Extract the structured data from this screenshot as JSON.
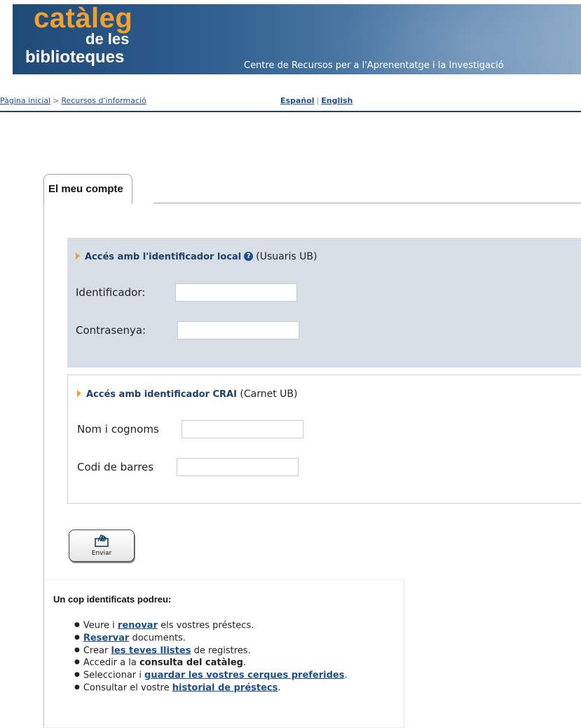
{
  "header": {
    "logo_line1": "catàleg",
    "logo_line2": "de les",
    "logo_line3": "biblioteques",
    "subtitle": "Centre de Recursos per a l'Aprenentatge i la Investigació"
  },
  "breadcrumb": {
    "home": "Pàgina inicial",
    "separator": ">",
    "current": "Recursos d'informació"
  },
  "languages": {
    "spanish": "Español",
    "divider": "|",
    "english": "English"
  },
  "account": {
    "tab_label": "El meu compte",
    "local": {
      "title_link": "Accés amb l'identificador local",
      "help_icon": "?",
      "title_suffix": "(Usuaris UB)",
      "id_label": "Identificador:",
      "id_value": "",
      "password_label": "Contrasenya:",
      "password_value": ""
    },
    "crai": {
      "title_link": "Accés amb identificador CRAI",
      "title_suffix": "(Carnet UB)",
      "name_label": "Nom i cognoms",
      "name_value": "",
      "barcode_label": "Codi de barres",
      "barcode_value": ""
    },
    "submit_label": "Enviar"
  },
  "info": {
    "title": "Un cop identificats podreu:",
    "items": [
      {
        "pre": "Veure i ",
        "link": "renovar",
        "post": " els vostres préstecs."
      },
      {
        "pre": "",
        "link": "Reservar",
        "post": " documents."
      },
      {
        "pre": "Crear ",
        "link": "les teves llistes",
        "post": " de registres."
      },
      {
        "pre": "Accedir a la ",
        "bold": "consulta del catàleg",
        "post": "."
      },
      {
        "pre": "Seleccionar i ",
        "link": "guardar les vostres cerques preferides",
        "post": "."
      },
      {
        "pre": "Consultar el vostre ",
        "link": "historial de préstecs",
        "post": "."
      }
    ]
  },
  "colors": {
    "banner_accent": "#f2a12c",
    "link": "#1f4f88",
    "panel_bg": "#d8dee6"
  },
  "icons": {
    "section_arrow": "triangle-arrow-icon",
    "help": "help-icon",
    "submit": "hand-card-icon"
  }
}
